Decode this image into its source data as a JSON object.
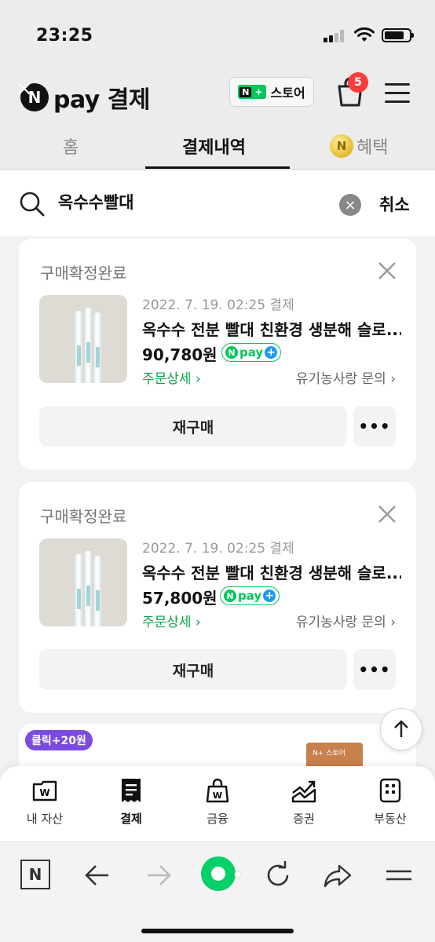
{
  "status_bar": {
    "time": "23:25"
  },
  "header": {
    "logo_letter": "N",
    "title": "pay 결제",
    "store_badge_n": "N",
    "store_badge_plus": "+",
    "store_label": "스토어",
    "cart_count": "5"
  },
  "tabs": [
    {
      "label": "홈"
    },
    {
      "label": "결제내역"
    },
    {
      "label": "혜택",
      "icon_text": "N"
    }
  ],
  "search": {
    "value": "옥수수빨대",
    "cancel_label": "취소"
  },
  "orders": [
    {
      "status": "구매확정완료",
      "date": "2022. 7. 19. 02:25 결제",
      "product_name": "옥수수 전분 빨대 친환경 생분해 슬로...",
      "price": "90,780원",
      "npay_label": "pay",
      "detail_link": "주문상세",
      "seller_link": "유기농사랑 문의",
      "rebuy_label": "재구매",
      "more_label": "•••"
    },
    {
      "status": "구매확정완료",
      "date": "2022. 7. 19. 02:25 결제",
      "product_name": "옥수수 전분 빨대 친환경 생분해 슬로...",
      "price": "57,800원",
      "npay_label": "pay",
      "detail_link": "주문상세",
      "seller_link": "유기농사랑 문의",
      "rebuy_label": "재구매",
      "more_label": "•••"
    }
  ],
  "promo": {
    "badge": "클릭+20원",
    "box_text": "N+ 스토어"
  },
  "bottom_nav": [
    {
      "label": "내 자산",
      "icon": "wallet-icon"
    },
    {
      "label": "결제",
      "icon": "receipt-icon",
      "active": true
    },
    {
      "label": "금융",
      "icon": "money-bag-icon"
    },
    {
      "label": "증권",
      "icon": "stock-chart-icon"
    },
    {
      "label": "부동산",
      "icon": "building-icon"
    }
  ],
  "browser_bar": {
    "n_label": "N"
  },
  "colors": {
    "npay_green": "#03c75a",
    "badge_red": "#ff3c3c",
    "promo_purple": "#7b4be0"
  }
}
